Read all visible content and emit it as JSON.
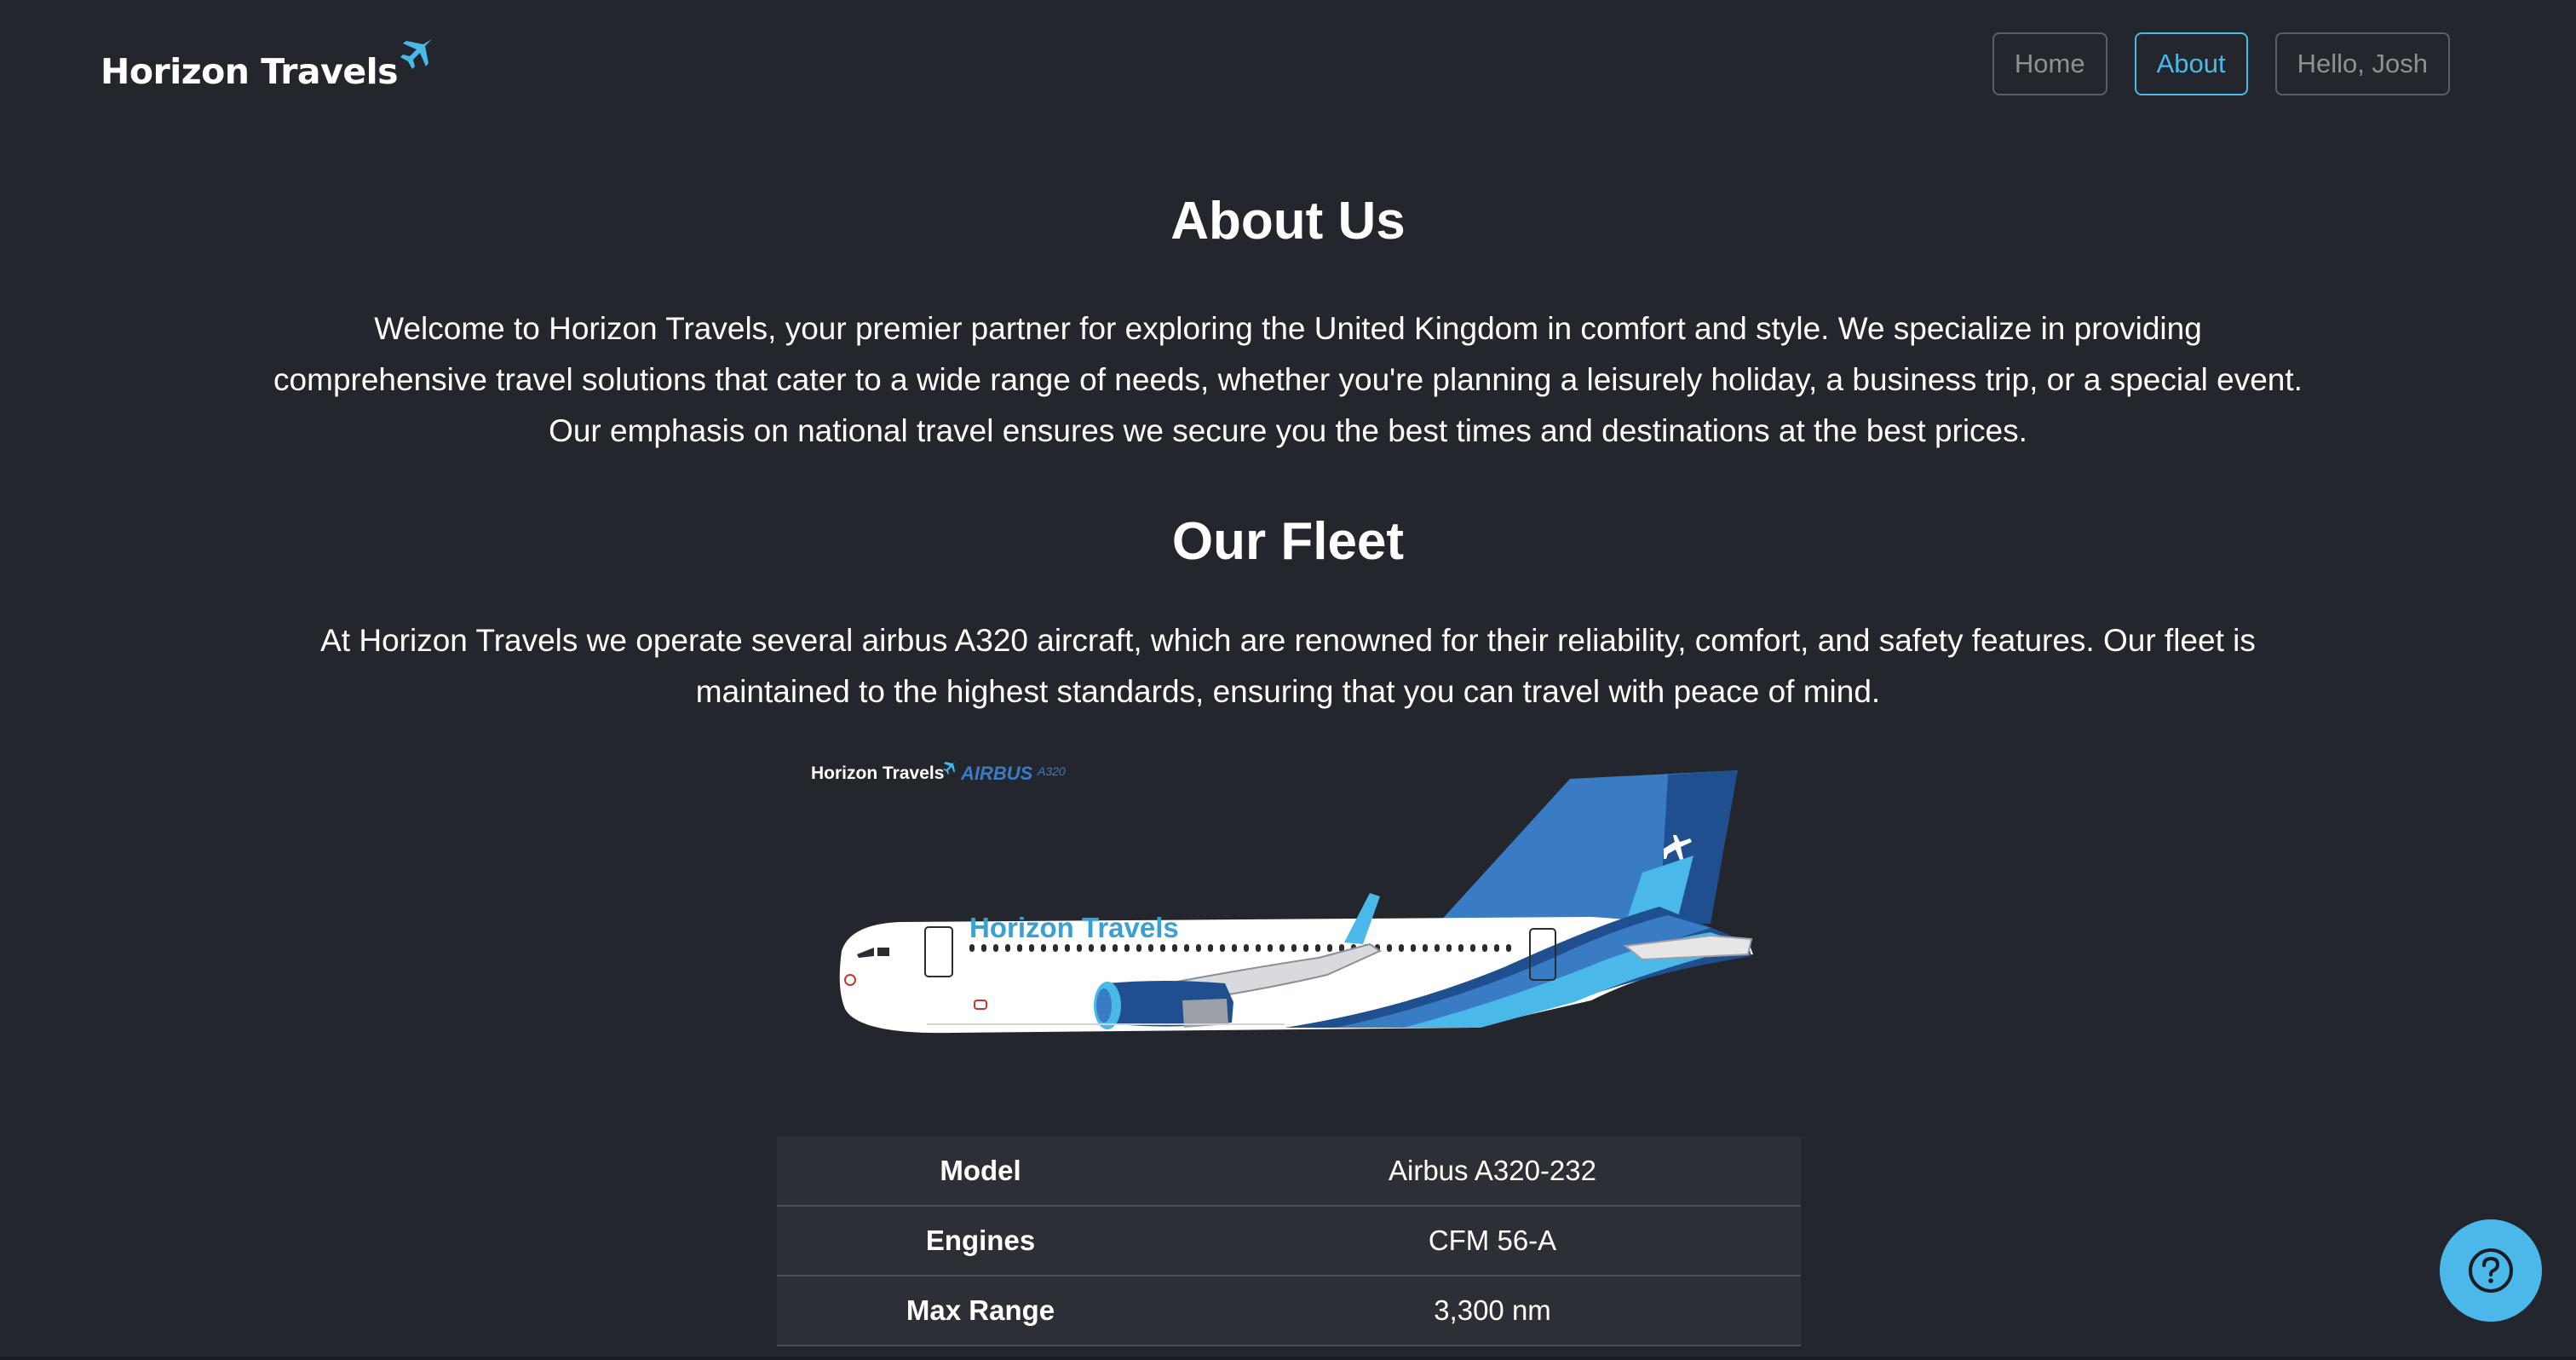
{
  "header": {
    "logo_text": "Horizon Travels",
    "nav": {
      "home": "Home",
      "about": "About",
      "user": "Hello, Josh"
    }
  },
  "about": {
    "title": "About Us",
    "paragraph": "Welcome to Horizon Travels, your premier partner for exploring the United Kingdom in comfort and style. We specialize in providing comprehensive travel solutions that cater to a wide range of needs, whether you're planning a leisurely holiday, a business trip, or a special event. Our emphasis on national travel ensures we secure you the best times and destinations at the best prices."
  },
  "fleet": {
    "title": "Our Fleet",
    "paragraph": "At Horizon Travels we operate several airbus A320 aircraft, which are renowned for their reliability, comfort, and safety features. Our fleet is maintained to the highest standards, ensuring that you can travel with peace of mind.",
    "image": {
      "caption_brand": "Horizon Travels",
      "caption_maker": "AIRBUS",
      "caption_model": "A320",
      "livery_text": "Horizon Travels"
    },
    "specs": [
      {
        "key": "Model",
        "value": "Airbus A320-232"
      },
      {
        "key": "Engines",
        "value": "CFM 56-A"
      },
      {
        "key": "Max Range",
        "value": "3,300 nm"
      }
    ]
  },
  "help": {
    "icon": "question-circle-icon"
  },
  "colors": {
    "background": "#23272d",
    "accent": "#4ab8e8",
    "table_row": "#2c3036",
    "nav_border": "#5a5f66",
    "livery_dark": "#1f4f8f",
    "livery_mid": "#3a7cc4",
    "livery_light": "#4ab8e8"
  }
}
